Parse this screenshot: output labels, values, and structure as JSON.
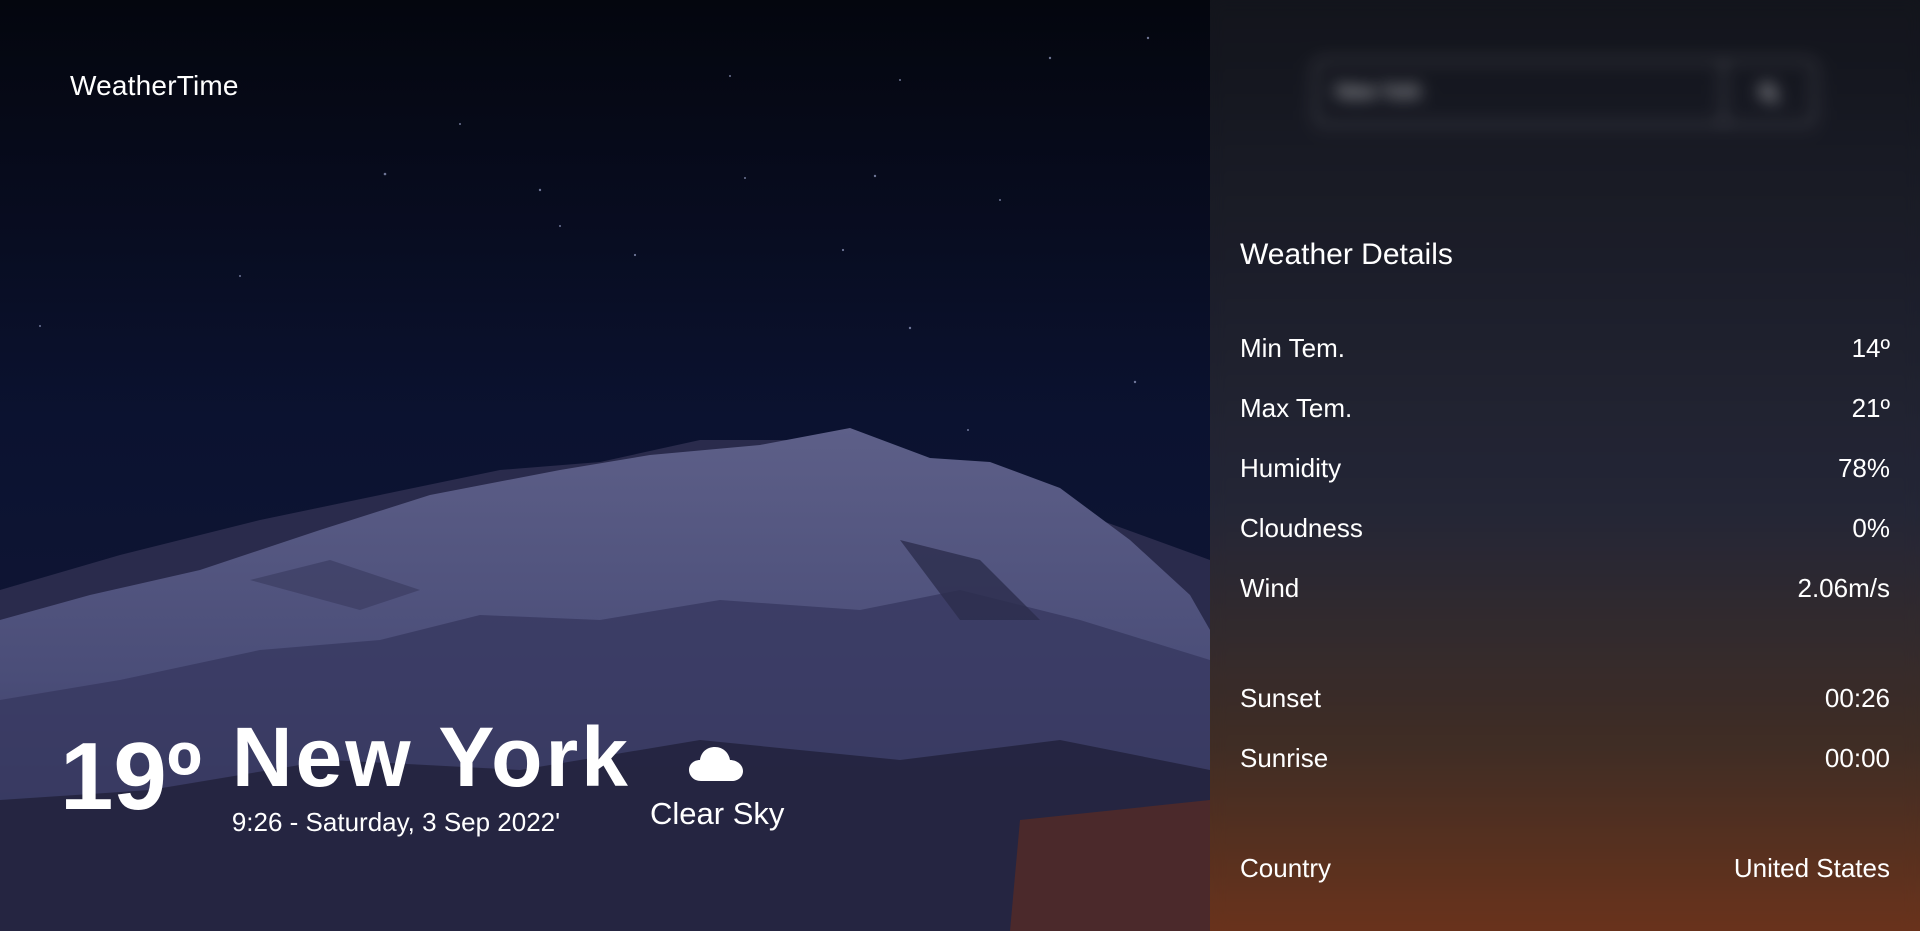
{
  "app": {
    "logo": "WeatherTime"
  },
  "search": {
    "value": "New York",
    "button_icon": "search-icon"
  },
  "current": {
    "temperature": "19º",
    "city": "New York",
    "datetime": "9:26 - Saturday, 3 Sep 2022'",
    "condition_icon": "cloud-icon",
    "condition": "Clear Sky"
  },
  "details": {
    "title": "Weather Details",
    "rows": [
      {
        "label": "Min Tem.",
        "value": "14º"
      },
      {
        "label": "Max Tem.",
        "value": "21º"
      },
      {
        "label": "Humidity",
        "value": "78%"
      },
      {
        "label": "Cloudness",
        "value": "0%"
      },
      {
        "label": "Wind",
        "value": "2.06m/s"
      },
      {
        "label": "Sunset",
        "value": "00:26"
      },
      {
        "label": "Sunrise",
        "value": "00:00"
      },
      {
        "label": "Country",
        "value": "United States"
      }
    ]
  }
}
